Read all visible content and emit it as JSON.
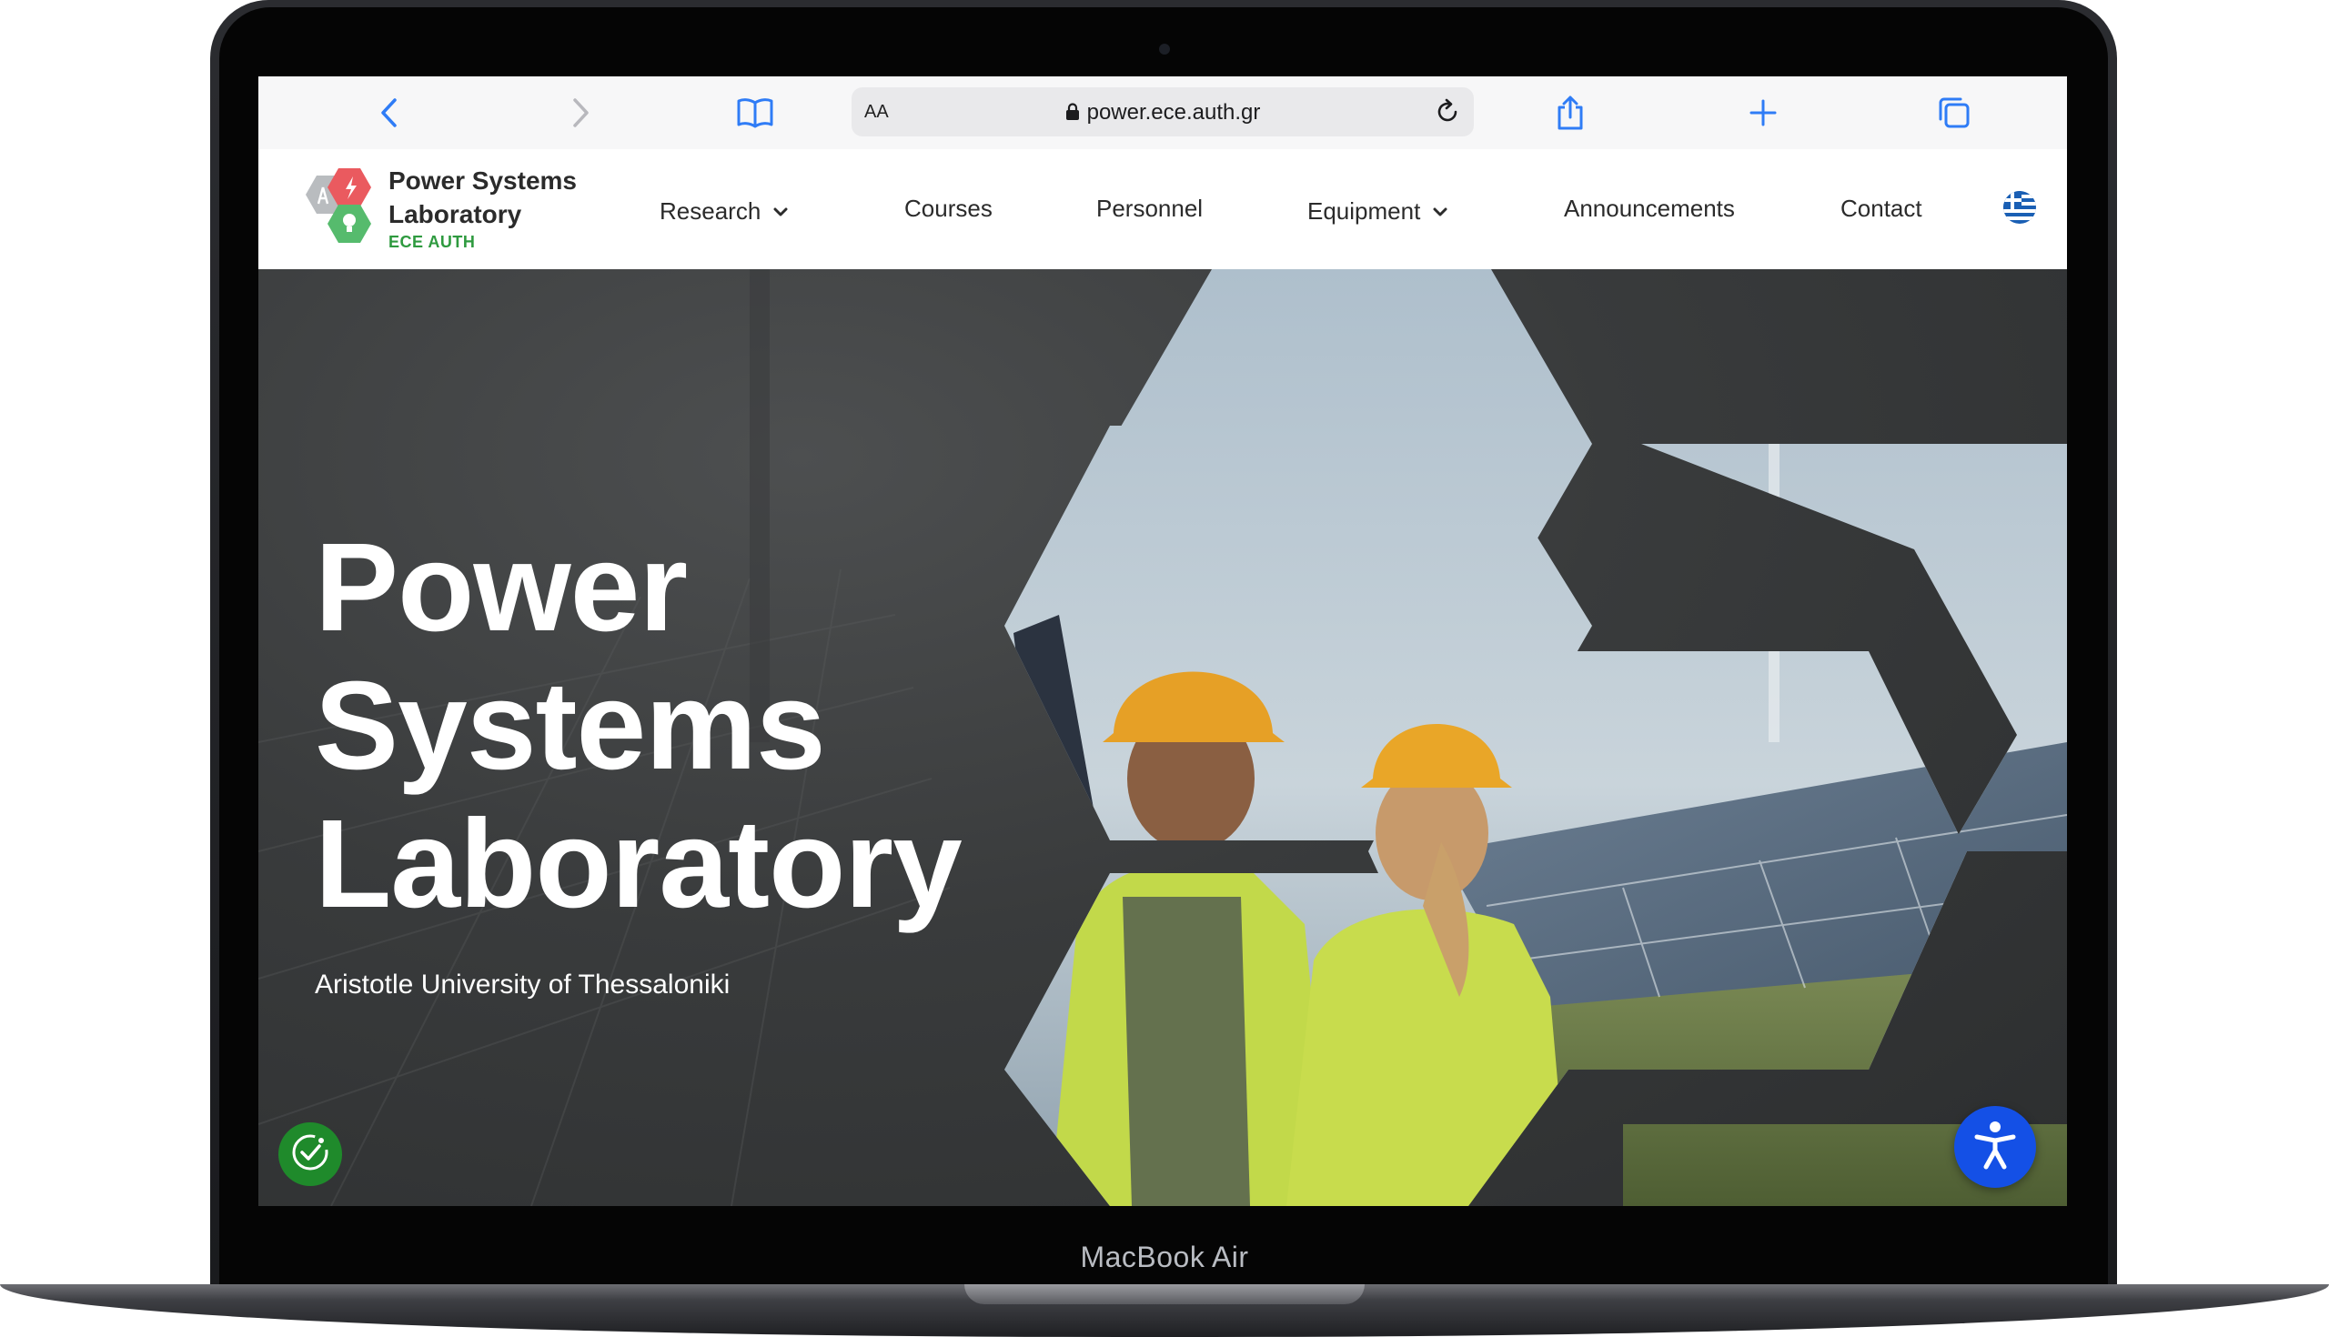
{
  "browser": {
    "address_size_label": "AA",
    "url": "power.ece.auth.gr"
  },
  "site": {
    "logo_title": "Power Systems Laboratory",
    "logo_subtitle": "ECE AUTH",
    "nav": [
      {
        "label": "Research",
        "has_dropdown": true
      },
      {
        "label": "Courses",
        "has_dropdown": false
      },
      {
        "label": "Personnel",
        "has_dropdown": false
      },
      {
        "label": "Equipment",
        "has_dropdown": true
      },
      {
        "label": "Announcements",
        "has_dropdown": false
      },
      {
        "label": "Contact",
        "has_dropdown": false
      }
    ],
    "language_flag": "greek-flag-icon"
  },
  "hero": {
    "title": "Power Systems Laboratory",
    "subtitle": "Aristotle University of Thessaloniki"
  },
  "floating": {
    "accessibility_icon": "accessibility-icon",
    "cookie_icon": "cookie-consent-icon"
  },
  "device": {
    "label": "MacBook Air"
  },
  "colors": {
    "brand_green": "#2e9a3f",
    "brand_red": "#e8545a",
    "accessibility_blue": "#1450e6",
    "safari_blue": "#2f7cf6"
  }
}
